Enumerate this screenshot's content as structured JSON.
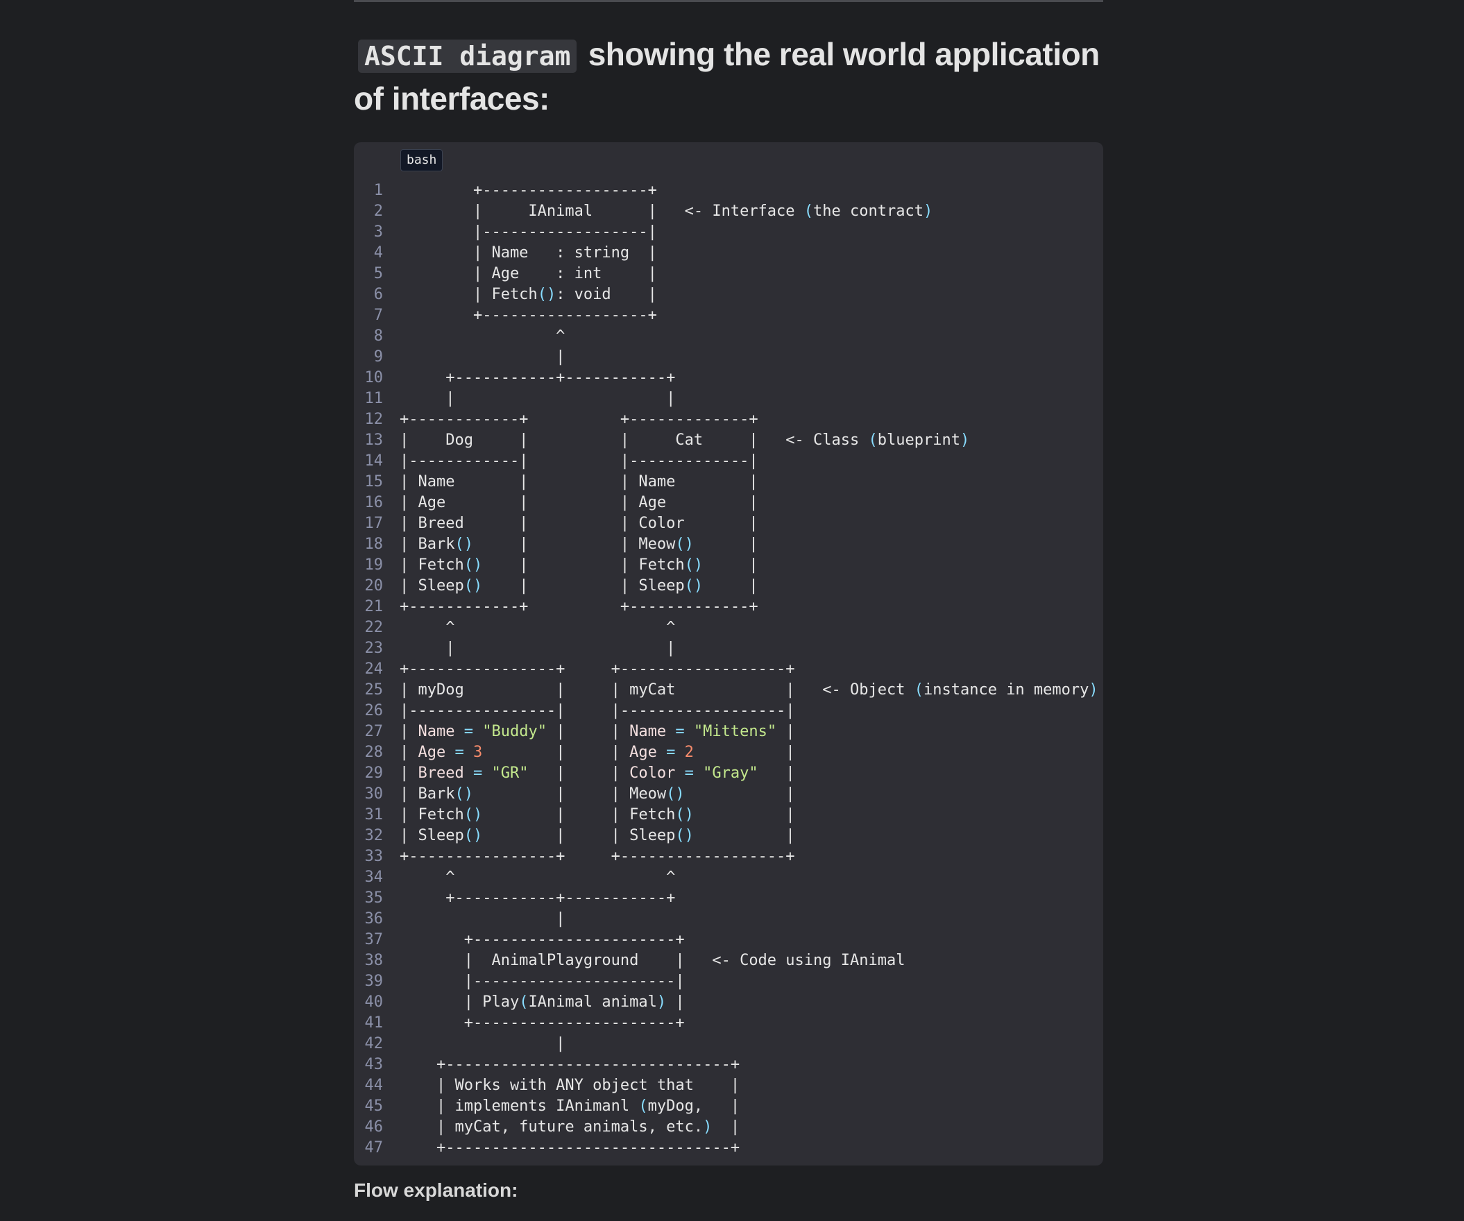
{
  "heading": {
    "code_text": "ASCII diagram",
    "text": "showing the real world application of interfaces:"
  },
  "code_block": {
    "language": "bash",
    "lines": [
      "        +------------------+",
      "        |     IAnimal      |   <- Interface (the contract)",
      "        |------------------|",
      "        | Name   : string  |",
      "        | Age    : int     |",
      "        | Fetch(): void    |",
      "        +------------------+",
      "                 ^",
      "                 |",
      "     +-----------+-----------+",
      "     |                       |",
      "+------------+          +-------------+",
      "|    Dog     |          |     Cat     |   <- Class (blueprint)",
      "|------------|          |-------------|",
      "| Name       |          | Name        |",
      "| Age        |          | Age         |",
      "| Breed      |          | Color       |",
      "| Bark()     |          | Meow()      |",
      "| Fetch()    |          | Fetch()     |",
      "| Sleep()    |          | Sleep()     |",
      "+------------+          +-------------+",
      "     ^                       ^",
      "     |                       |",
      "+----------------+     +------------------+",
      "| myDog          |     | myCat            |   <- Object (instance in memory)",
      "|----------------|     |------------------|",
      "| Name = \"Buddy\" |     | Name = \"Mittens\" |",
      "| Age = 3        |     | Age = 2          |",
      "| Breed = \"GR\"   |     | Color = \"Gray\"   |",
      "| Bark()         |     | Meow()           |",
      "| Fetch()        |     | Fetch()          |",
      "| Sleep()        |     | Sleep()          |",
      "+----------------+     +------------------+",
      "     ^                       ^",
      "     +-----------+-----------+",
      "                 |",
      "       +----------------------+",
      "       |  AnimalPlayground    |   <- Code using IAnimal",
      "       |----------------------|",
      "       | Play(IAnimal animal) |",
      "       +----------------------+",
      "                 |",
      "    +-------------------------------+",
      "    | Works with ANY object that    |",
      "    | implements IAnimanl (myDog,   |",
      "    | myCat, future animals, etc.)  |",
      "    +-------------------------------+"
    ]
  },
  "flow_heading": "Flow explanation:"
}
